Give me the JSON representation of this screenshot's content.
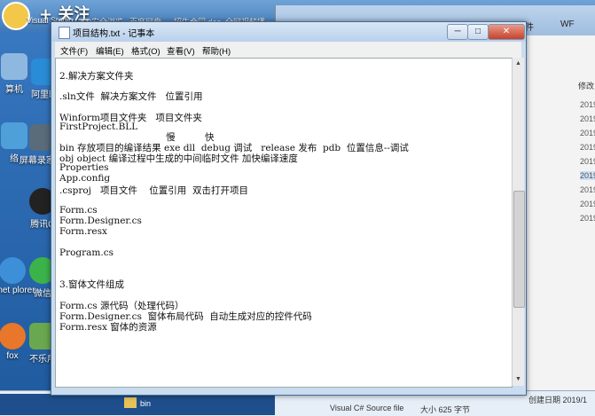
{
  "top": {
    "follow_label": "+ 关注",
    "items": [
      "Visual Studio",
      "360安全浏览",
      "百度网盘",
      "招生合同.doc",
      "全网视频播"
    ]
  },
  "desktop_icons": [
    "算机",
    "阿里旺",
    "络",
    "屏幕录家V2",
    "腾讯Q",
    "ernet plorer",
    "微信",
    "fox",
    "不乐用"
  ],
  "explorer": {
    "crumbs": [
      "件",
      "WF"
    ],
    "column_header": "修改",
    "dates": [
      "2019",
      "2019",
      "2019",
      "2019",
      "2019",
      "2019",
      "2019",
      "2019",
      "2019"
    ],
    "footer_left": "Visual C# Source file",
    "footer_size": "大小 625 字节",
    "footer_right": "创建日期 2019/1",
    "bin_label": "bin"
  },
  "notepad": {
    "title": "项目结构.txt - 记事本",
    "minimize": "─",
    "maximize": "□",
    "close": "✕",
    "menu": [
      "文件(F)",
      "编辑(E)",
      "格式(O)",
      "查看(V)",
      "帮助(H)"
    ],
    "lines": [
      "2.解决方案文件夹",
      "",
      ".sln文件  解决方案文件   位置引用",
      "",
      "Winform项目文件夹   项目文件夹",
      "FirstProject.BLL",
      "                                    慢          快",
      "bin 存放项目的编译结果 exe dll  debug 调试   release 发布  pdb  位置信息--调试",
      "obj object 编译过程中生成的中间临时文件 加快编译速度",
      "Properties",
      "App.config",
      ".csproj   项目文件    位置引用  双击打开项目",
      "",
      "Form.cs",
      "Form.Designer.cs",
      "Form.resx",
      "",
      "Program.cs",
      "",
      "",
      "3.窗体文件组成",
      "",
      "Form.cs 源代码（处理代码）",
      "Form.Designer.cs  窗体布局代码  自动生成对应的控件代码",
      "Form.resx 窗体的资源"
    ]
  }
}
